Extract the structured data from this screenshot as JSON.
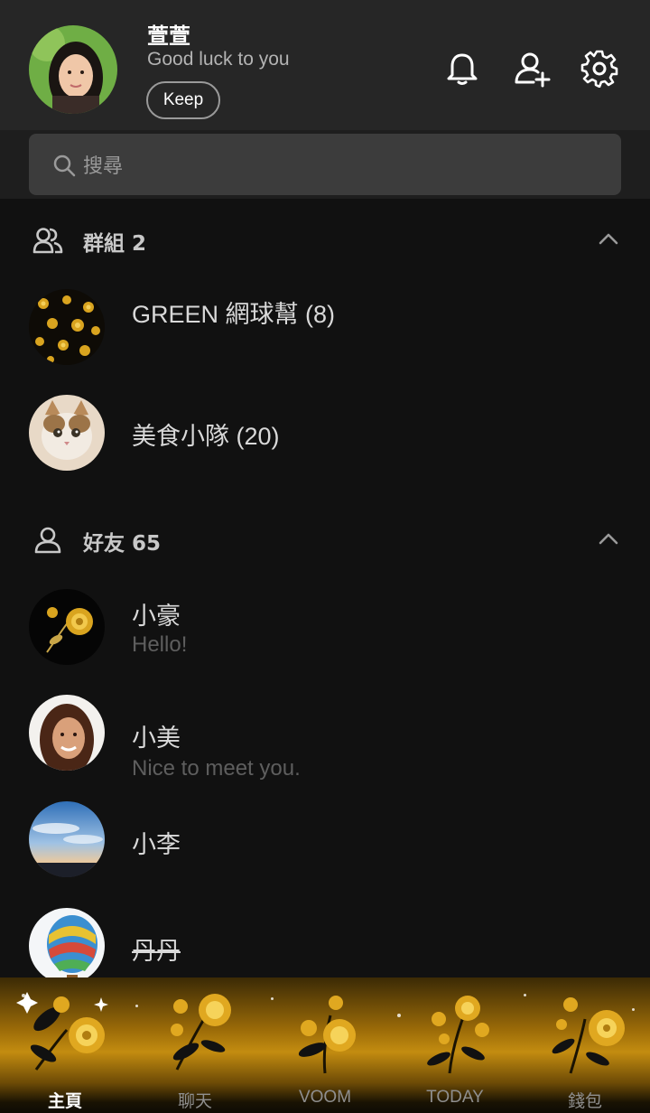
{
  "header": {
    "name": "萱萱",
    "status": "Good luck to you",
    "keep_label": "Keep",
    "icons": [
      "bell-icon",
      "add-friend-icon",
      "settings-icon"
    ]
  },
  "search": {
    "placeholder": "搜尋"
  },
  "groups": {
    "title": "群組 2",
    "items": [
      {
        "name": "GREEN 網球幫 (8)",
        "avatar": "gold-roses-pattern"
      },
      {
        "name": "美食小隊 (20)",
        "avatar": "cat-photo"
      }
    ]
  },
  "friends": {
    "title": "好友 65",
    "items": [
      {
        "name": "小豪",
        "status": "Hello!",
        "avatar": "gold-rose"
      },
      {
        "name": "小美",
        "status": "Nice to meet you.",
        "avatar": "woman-photo"
      },
      {
        "name": "小李",
        "status": "",
        "avatar": "sky-photo"
      },
      {
        "name": "丹丹",
        "status": "",
        "avatar": "hot-air-balloon"
      }
    ]
  },
  "nav": {
    "tabs": [
      {
        "label": "主頁",
        "active": true
      },
      {
        "label": "聊天",
        "active": false
      },
      {
        "label": "VOOM",
        "active": false
      },
      {
        "label": "TODAY",
        "active": false
      },
      {
        "label": "錢包",
        "active": false
      }
    ]
  },
  "colors": {
    "background": "#111111",
    "header": "#262626",
    "search": "#3c3c3c",
    "gold": "#c38c10"
  }
}
